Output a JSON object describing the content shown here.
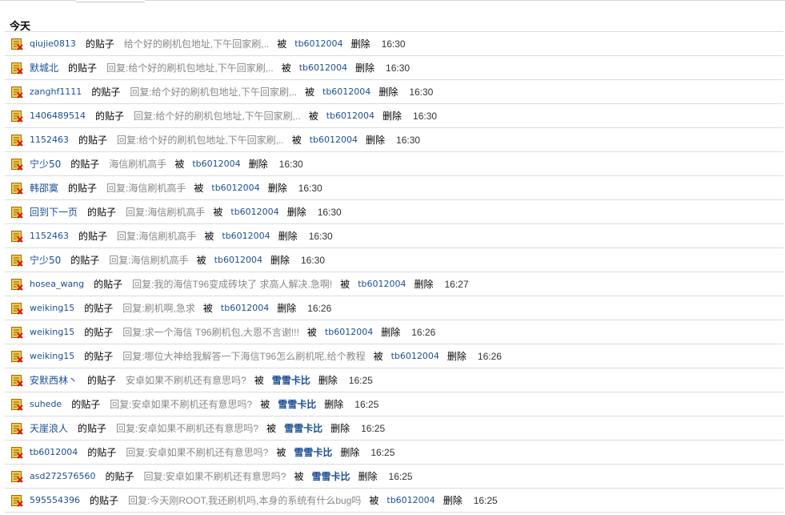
{
  "section_title": "今天",
  "labels": {
    "of_post": "的贴子",
    "by": "被",
    "deleted": "删除"
  },
  "rows": [
    {
      "user": "qiujie0813",
      "content": "给个好的刷机包地址,下午回家刷,..",
      "target": "tb6012004",
      "time": "16:30"
    },
    {
      "user": "默城北",
      "content": "回复:给个好的刷机包地址,下午回家刷,..",
      "target": "tb6012004",
      "time": "16:30"
    },
    {
      "user": "zanghf1111",
      "content": "回复:给个好的刷机包地址,下午回家刷,..",
      "target": "tb6012004",
      "time": "16:30"
    },
    {
      "user": "1406489514",
      "content": "回复:给个好的刷机包地址,下午回家刷,..",
      "target": "tb6012004",
      "time": "16:30"
    },
    {
      "user": "1152463",
      "content": "回复:给个好的刷机包地址,下午回家刷,..",
      "target": "tb6012004",
      "time": "16:30"
    },
    {
      "user": "宁少50",
      "content": "海信刷机高手",
      "target": "tb6012004",
      "time": "16:30"
    },
    {
      "user": "韩邵寞",
      "content": "回复:海信刷机高手",
      "target": "tb6012004",
      "time": "16:30"
    },
    {
      "user": "回到下一页",
      "content": "回复:海信刷机高手",
      "target": "tb6012004",
      "time": "16:30"
    },
    {
      "user": "1152463",
      "content": "回复:海信刷机高手",
      "target": "tb6012004",
      "time": "16:30"
    },
    {
      "user": "宁少50",
      "content": "回复:海信刷机高手",
      "target": "tb6012004",
      "time": "16:30"
    },
    {
      "user": "hosea_wang",
      "content": "回复:我的海信T96变成砖块了 求高人解决.急啊!",
      "target": "tb6012004",
      "time": "16:27"
    },
    {
      "user": "weiking15",
      "content": "回复:刷机啊,急求",
      "target": "tb6012004",
      "time": "16:26"
    },
    {
      "user": "weiking15",
      "content": "回复:求一个海信 T96刷机包,大恩不言谢!!!",
      "target": "tb6012004",
      "time": "16:26"
    },
    {
      "user": "weiking15",
      "content": "回复:哪位大神给我解答一下海信T96怎么刷机呢,给个教程",
      "target": "tb6012004",
      "time": "16:26"
    },
    {
      "user": "安默西林丶",
      "content": "安卓如果不刷机还有意思吗?",
      "target": "雪雪卡比",
      "time": "16:25"
    },
    {
      "user": "suhede",
      "content": "回复:安卓如果不刷机还有意思吗?",
      "target": "雪雪卡比",
      "time": "16:25"
    },
    {
      "user": "天崖浪人",
      "content": "回复:安卓如果不刷机还有意思吗?",
      "target": "雪雪卡比",
      "time": "16:25"
    },
    {
      "user": "tb6012004",
      "content": "回复:安卓如果不刷机还有意思吗?",
      "target": "雪雪卡比",
      "time": "16:25"
    },
    {
      "user": "asd272576560",
      "content": "回复:安卓如果不刷机还有意思吗?",
      "target": "雪雪卡比",
      "time": "16:25"
    },
    {
      "user": "595554396",
      "content": "回复:今天刚ROOT,我还刷机吗,本身的系统有什么bug吗",
      "target": "tb6012004",
      "time": "16:25"
    }
  ]
}
